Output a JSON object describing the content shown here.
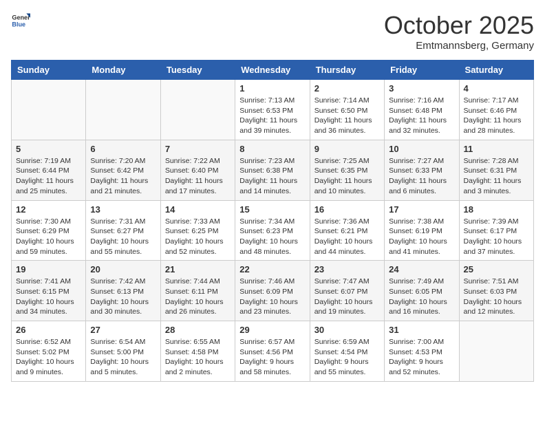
{
  "header": {
    "logo_general": "General",
    "logo_blue": "Blue",
    "month_title": "October 2025",
    "location": "Emtmannsberg, Germany"
  },
  "weekdays": [
    "Sunday",
    "Monday",
    "Tuesday",
    "Wednesday",
    "Thursday",
    "Friday",
    "Saturday"
  ],
  "weeks": [
    [
      {
        "day": "",
        "info": ""
      },
      {
        "day": "",
        "info": ""
      },
      {
        "day": "",
        "info": ""
      },
      {
        "day": "1",
        "info": "Sunrise: 7:13 AM\nSunset: 6:53 PM\nDaylight: 11 hours\nand 39 minutes."
      },
      {
        "day": "2",
        "info": "Sunrise: 7:14 AM\nSunset: 6:50 PM\nDaylight: 11 hours\nand 36 minutes."
      },
      {
        "day": "3",
        "info": "Sunrise: 7:16 AM\nSunset: 6:48 PM\nDaylight: 11 hours\nand 32 minutes."
      },
      {
        "day": "4",
        "info": "Sunrise: 7:17 AM\nSunset: 6:46 PM\nDaylight: 11 hours\nand 28 minutes."
      }
    ],
    [
      {
        "day": "5",
        "info": "Sunrise: 7:19 AM\nSunset: 6:44 PM\nDaylight: 11 hours\nand 25 minutes."
      },
      {
        "day": "6",
        "info": "Sunrise: 7:20 AM\nSunset: 6:42 PM\nDaylight: 11 hours\nand 21 minutes."
      },
      {
        "day": "7",
        "info": "Sunrise: 7:22 AM\nSunset: 6:40 PM\nDaylight: 11 hours\nand 17 minutes."
      },
      {
        "day": "8",
        "info": "Sunrise: 7:23 AM\nSunset: 6:38 PM\nDaylight: 11 hours\nand 14 minutes."
      },
      {
        "day": "9",
        "info": "Sunrise: 7:25 AM\nSunset: 6:35 PM\nDaylight: 11 hours\nand 10 minutes."
      },
      {
        "day": "10",
        "info": "Sunrise: 7:27 AM\nSunset: 6:33 PM\nDaylight: 11 hours\nand 6 minutes."
      },
      {
        "day": "11",
        "info": "Sunrise: 7:28 AM\nSunset: 6:31 PM\nDaylight: 11 hours\nand 3 minutes."
      }
    ],
    [
      {
        "day": "12",
        "info": "Sunrise: 7:30 AM\nSunset: 6:29 PM\nDaylight: 10 hours\nand 59 minutes."
      },
      {
        "day": "13",
        "info": "Sunrise: 7:31 AM\nSunset: 6:27 PM\nDaylight: 10 hours\nand 55 minutes."
      },
      {
        "day": "14",
        "info": "Sunrise: 7:33 AM\nSunset: 6:25 PM\nDaylight: 10 hours\nand 52 minutes."
      },
      {
        "day": "15",
        "info": "Sunrise: 7:34 AM\nSunset: 6:23 PM\nDaylight: 10 hours\nand 48 minutes."
      },
      {
        "day": "16",
        "info": "Sunrise: 7:36 AM\nSunset: 6:21 PM\nDaylight: 10 hours\nand 44 minutes."
      },
      {
        "day": "17",
        "info": "Sunrise: 7:38 AM\nSunset: 6:19 PM\nDaylight: 10 hours\nand 41 minutes."
      },
      {
        "day": "18",
        "info": "Sunrise: 7:39 AM\nSunset: 6:17 PM\nDaylight: 10 hours\nand 37 minutes."
      }
    ],
    [
      {
        "day": "19",
        "info": "Sunrise: 7:41 AM\nSunset: 6:15 PM\nDaylight: 10 hours\nand 34 minutes."
      },
      {
        "day": "20",
        "info": "Sunrise: 7:42 AM\nSunset: 6:13 PM\nDaylight: 10 hours\nand 30 minutes."
      },
      {
        "day": "21",
        "info": "Sunrise: 7:44 AM\nSunset: 6:11 PM\nDaylight: 10 hours\nand 26 minutes."
      },
      {
        "day": "22",
        "info": "Sunrise: 7:46 AM\nSunset: 6:09 PM\nDaylight: 10 hours\nand 23 minutes."
      },
      {
        "day": "23",
        "info": "Sunrise: 7:47 AM\nSunset: 6:07 PM\nDaylight: 10 hours\nand 19 minutes."
      },
      {
        "day": "24",
        "info": "Sunrise: 7:49 AM\nSunset: 6:05 PM\nDaylight: 10 hours\nand 16 minutes."
      },
      {
        "day": "25",
        "info": "Sunrise: 7:51 AM\nSunset: 6:03 PM\nDaylight: 10 hours\nand 12 minutes."
      }
    ],
    [
      {
        "day": "26",
        "info": "Sunrise: 6:52 AM\nSunset: 5:02 PM\nDaylight: 10 hours\nand 9 minutes."
      },
      {
        "day": "27",
        "info": "Sunrise: 6:54 AM\nSunset: 5:00 PM\nDaylight: 10 hours\nand 5 minutes."
      },
      {
        "day": "28",
        "info": "Sunrise: 6:55 AM\nSunset: 4:58 PM\nDaylight: 10 hours\nand 2 minutes."
      },
      {
        "day": "29",
        "info": "Sunrise: 6:57 AM\nSunset: 4:56 PM\nDaylight: 9 hours\nand 58 minutes."
      },
      {
        "day": "30",
        "info": "Sunrise: 6:59 AM\nSunset: 4:54 PM\nDaylight: 9 hours\nand 55 minutes."
      },
      {
        "day": "31",
        "info": "Sunrise: 7:00 AM\nSunset: 4:53 PM\nDaylight: 9 hours\nand 52 minutes."
      },
      {
        "day": "",
        "info": ""
      }
    ]
  ]
}
